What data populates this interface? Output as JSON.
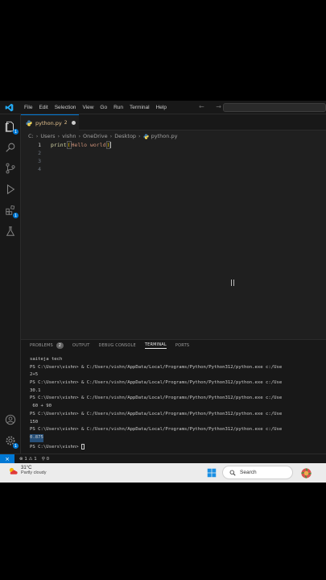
{
  "menu": [
    "File",
    "Edit",
    "Selection",
    "View",
    "Go",
    "Run",
    "Terminal",
    "Help"
  ],
  "nav": {
    "arrows": "← →"
  },
  "tab": {
    "label": "python.py",
    "suffix": "2"
  },
  "breadcrumb": [
    "C:",
    "Users",
    "vishn",
    "OneDrive",
    "Desktop",
    "python.py"
  ],
  "editor": {
    "lines": [
      "1",
      "2",
      "3",
      "4"
    ],
    "code_fn": "print",
    "code_open": "(",
    "code_str": "Hello world",
    "code_close": ")"
  },
  "panel": {
    "tabs": [
      "PROBLEMS",
      "OUTPUT",
      "DEBUG CONSOLE",
      "TERMINAL",
      "PORTS"
    ],
    "problems_count": "2",
    "active_tab": "TERMINAL"
  },
  "terminal": [
    "saiteja tech",
    "PS C:\\Users\\vishn> & C:/Users/vishn/AppData/Local/Programs/Python/Python312/python.exe c:/Use",
    "2+5",
    "PS C:\\Users\\vishn> & C:/Users/vishn/AppData/Local/Programs/Python/Python312/python.exe c:/Use",
    "30.1",
    "PS C:\\Users\\vishn> & C:/Users/vishn/AppData/Local/Programs/Python/Python312/python.exe c:/Use",
    " 60 + 90",
    "PS C:\\Users\\vishn> & C:/Users/vishn/AppData/Local/Programs/Python/Python312/python.exe c:/Use",
    "150",
    "PS C:\\Users\\vishn> & C:/Users/vishn/AppData/Local/Programs/Python/Python312/python.exe c:/Use",
    "0.875"
  ],
  "terminal_prompt": "PS C:\\Users\\vishn> ",
  "status": {
    "remote": "⨯",
    "problems": "⊗ 1 ⚠ 1",
    "ports": "⚲ 0"
  },
  "taskbar": {
    "temp": "31°C",
    "condition": "Partly cloudy",
    "search_label": "Search"
  },
  "colors": {
    "accent": "#0078d4",
    "string": "#ce9178",
    "function": "#dcdcaa",
    "tab_modified": "#e2c08d"
  }
}
